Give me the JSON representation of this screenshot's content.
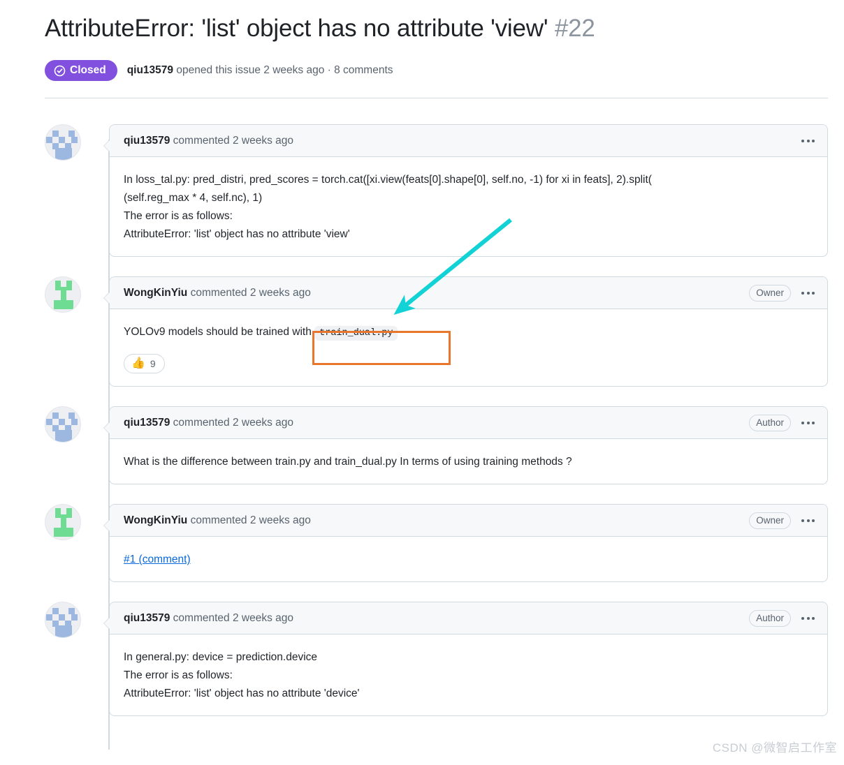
{
  "issue": {
    "title": "AttributeError: 'list' object has no attribute 'view'",
    "number": "#22",
    "state_label": "Closed",
    "state_color": "#8250DF",
    "author": "qiu13579",
    "meta_action": " opened this issue 2 weeks ago · 8 comments"
  },
  "comments": [
    {
      "author": "qiu13579",
      "action": " commented 2 weeks ago",
      "role_badge": null,
      "avatar_kind": "identicon-blue",
      "body_lines": [
        "In loss_tal.py: pred_distri, pred_scores = torch.cat([xi.view(feats[0].shape[0], self.no, -1) for xi in feats], 2).split(",
        "(self.reg_max * 4, self.nc), 1)",
        "The error is as follows:",
        "AttributeError: 'list' object has no attribute 'view'"
      ]
    },
    {
      "author": "WongKinYiu",
      "action": " commented 2 weeks ago",
      "role_badge": "Owner",
      "avatar_kind": "identicon-green",
      "body_prefix": "YOLOv9 models should be trained with ",
      "body_code": "train_dual.py",
      "reaction": {
        "emoji": "👍",
        "count": "9"
      }
    },
    {
      "author": "qiu13579",
      "action": " commented 2 weeks ago",
      "role_badge": "Author",
      "avatar_kind": "identicon-blue",
      "body_lines": [
        "What is the difference between train.py and train_dual.py In terms of using training methods ?"
      ]
    },
    {
      "author": "WongKinYiu",
      "action": " commented 2 weeks ago",
      "role_badge": "Owner",
      "avatar_kind": "identicon-green",
      "link_text": "#1 (comment)"
    },
    {
      "author": "qiu13579",
      "action": " commented 2 weeks ago",
      "role_badge": "Author",
      "avatar_kind": "identicon-blue",
      "body_lines": [
        "In general.py: device = prediction.device",
        "The error is as follows:",
        "AttributeError: 'list' object has no attribute 'device'"
      ]
    }
  ],
  "annotations": {
    "arrow_color": "#12D2D6",
    "box_color": "#E8762C"
  },
  "watermark": "CSDN @微智启工作室"
}
